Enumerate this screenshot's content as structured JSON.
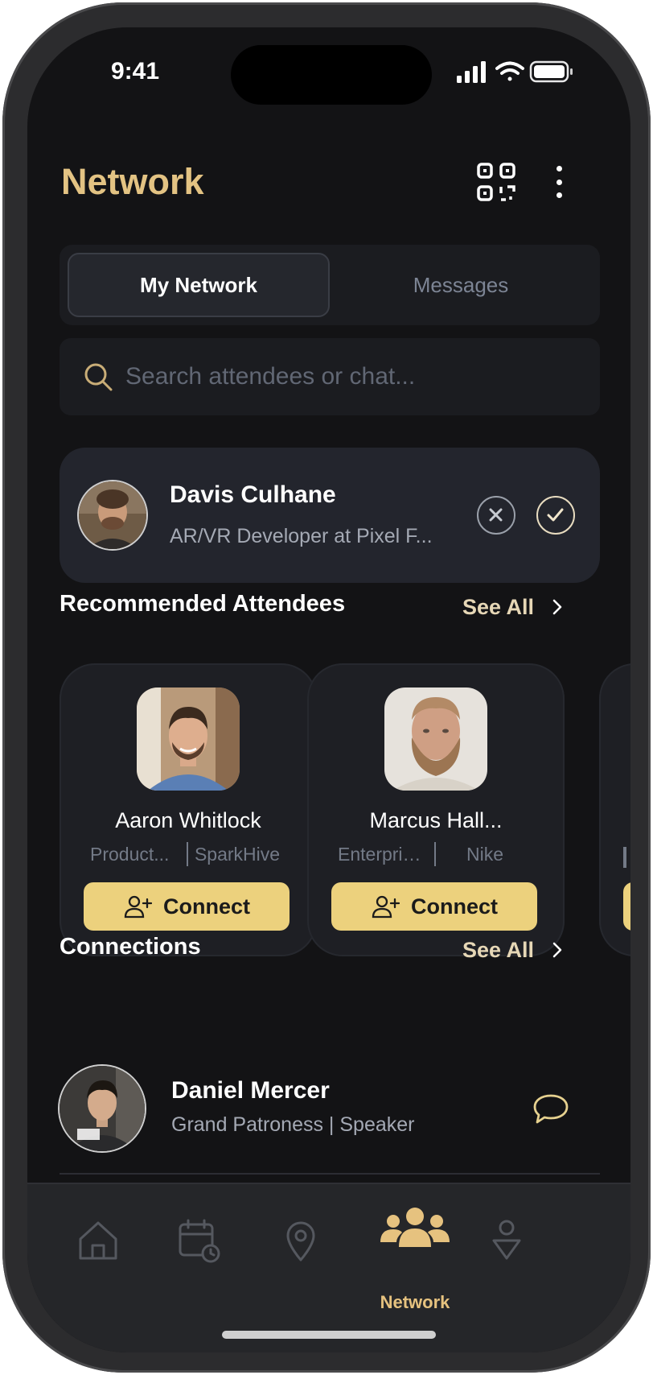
{
  "status_bar": {
    "time": "9:41"
  },
  "header": {
    "title": "Network"
  },
  "tabs": [
    {
      "label": "My Network",
      "active": true
    },
    {
      "label": "Messages",
      "active": false
    }
  ],
  "search": {
    "placeholder": "Search attendees or chat..."
  },
  "request": {
    "name": "Davis Culhane",
    "role": "AR/VR Developer at Pixel F..."
  },
  "recommended": {
    "title": "Recommended Attendees",
    "see_all": "See All",
    "cards": [
      {
        "name": "Aaron Whitlock",
        "role": "Product...",
        "company": "SparkHive",
        "button": "Connect"
      },
      {
        "name": "Marcus Hall...",
        "role": "Enterpris...",
        "company": "Nike",
        "button": "Connect"
      }
    ]
  },
  "connections": {
    "title": "Connections",
    "see_all": "See All",
    "items": [
      {
        "name": "Daniel Mercer",
        "role": "Grand Patroness | Speaker"
      }
    ]
  },
  "nav": {
    "items": [
      {
        "icon": "home-icon"
      },
      {
        "icon": "calendar-icon"
      },
      {
        "icon": "location-pin-icon"
      },
      {
        "icon": "people-icon",
        "label": "Network",
        "active": true
      },
      {
        "icon": "user-icon"
      }
    ]
  },
  "colors": {
    "accent": "#e3c383",
    "button": "#ecd17d",
    "background": "#131315",
    "card": "#1e1f24"
  }
}
